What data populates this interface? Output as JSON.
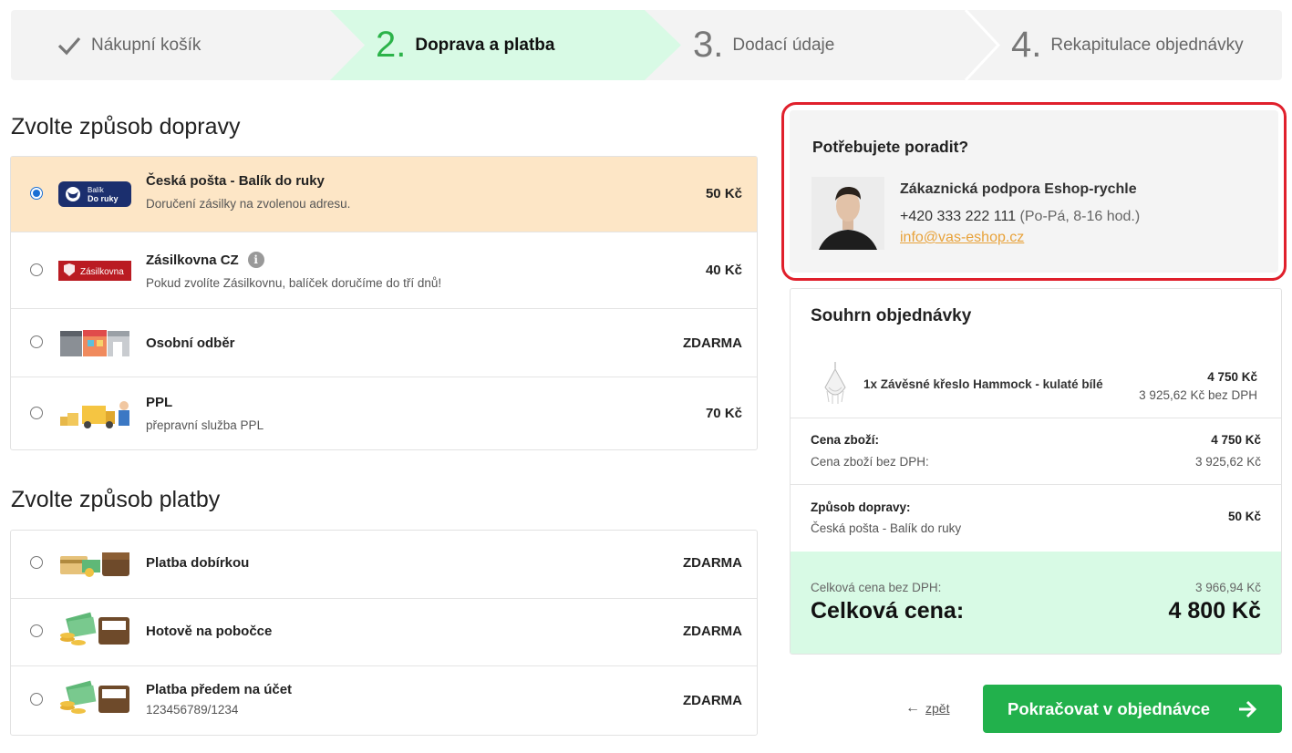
{
  "steps": [
    {
      "num": "",
      "label": "Nákupní košík",
      "state": "done"
    },
    {
      "num": "2.",
      "label": "Doprava a platba",
      "state": "active"
    },
    {
      "num": "3.",
      "label": "Dodací údaje",
      "state": "todo"
    },
    {
      "num": "4.",
      "label": "Rekapitulace objednávky",
      "state": "todo"
    }
  ],
  "shipping": {
    "title": "Zvolte způsob dopravy",
    "options": [
      {
        "name": "Česká pošta - Balík do ruky",
        "desc": "Doručení zásilky na zvolenou adresu.",
        "price": "50 Kč",
        "selected": true,
        "logo_text_1": "Balík",
        "logo_text_2": "Do ruky"
      },
      {
        "name": "Zásilkovna CZ",
        "desc": "Pokud zvolíte Zásilkovnu, balíček doručíme do tří dnů!",
        "price": "40 Kč",
        "selected": false,
        "logo_text": "Zásilkovna",
        "info": "i"
      },
      {
        "name": "Osobní odběr",
        "desc": "",
        "price": "ZDARMA",
        "selected": false
      },
      {
        "name": "PPL",
        "desc": "přepravní služba PPL",
        "price": "70 Kč",
        "selected": false
      }
    ]
  },
  "payment": {
    "title": "Zvolte způsob platby",
    "options": [
      {
        "name": "Platba dobírkou",
        "desc": "",
        "price": "ZDARMA",
        "selected": false
      },
      {
        "name": "Hotově na pobočce",
        "desc": "",
        "price": "ZDARMA",
        "selected": false
      },
      {
        "name": "Platba předem na účet",
        "desc": "123456789/1234",
        "price": "ZDARMA",
        "selected": false
      }
    ]
  },
  "help": {
    "title": "Potřebujete poradit?",
    "name": "Zákaznická podpora Eshop-rychle",
    "phone": "+420 333 222 111",
    "hours": "(Po-Pá, 8-16 hod.)",
    "email": "info@vas-eshop.cz"
  },
  "summary": {
    "title": "Souhrn objednávky",
    "item": {
      "name": "1x Závěsné křeslo Hammock - kulaté bílé",
      "price": "4 750 Kč",
      "price_no_vat": "3 925,62 Kč bez DPH"
    },
    "goods_label": "Cena zboží:",
    "goods_price": "4 750 Kč",
    "goods_no_vat_label": "Cena zboží bez DPH:",
    "goods_no_vat_price": "3 925,62 Kč",
    "shipping_label": "Způsob dopravy:",
    "shipping_name": "Česká pošta - Balík do ruky",
    "shipping_price": "50 Kč",
    "total_no_vat_label": "Celková cena bez DPH:",
    "total_no_vat": "3 966,94 Kč",
    "total_label": "Celková cena:",
    "total": "4 800 Kč"
  },
  "actions": {
    "back": "zpět",
    "continue": "Pokračovat v objednávce"
  },
  "colors": {
    "accent_green": "#22b14c",
    "active_step_bg": "#d8fae5",
    "selected_option_bg": "#fde6c6",
    "highlight_border": "#e0202c",
    "link_orange": "#e8a23a"
  }
}
